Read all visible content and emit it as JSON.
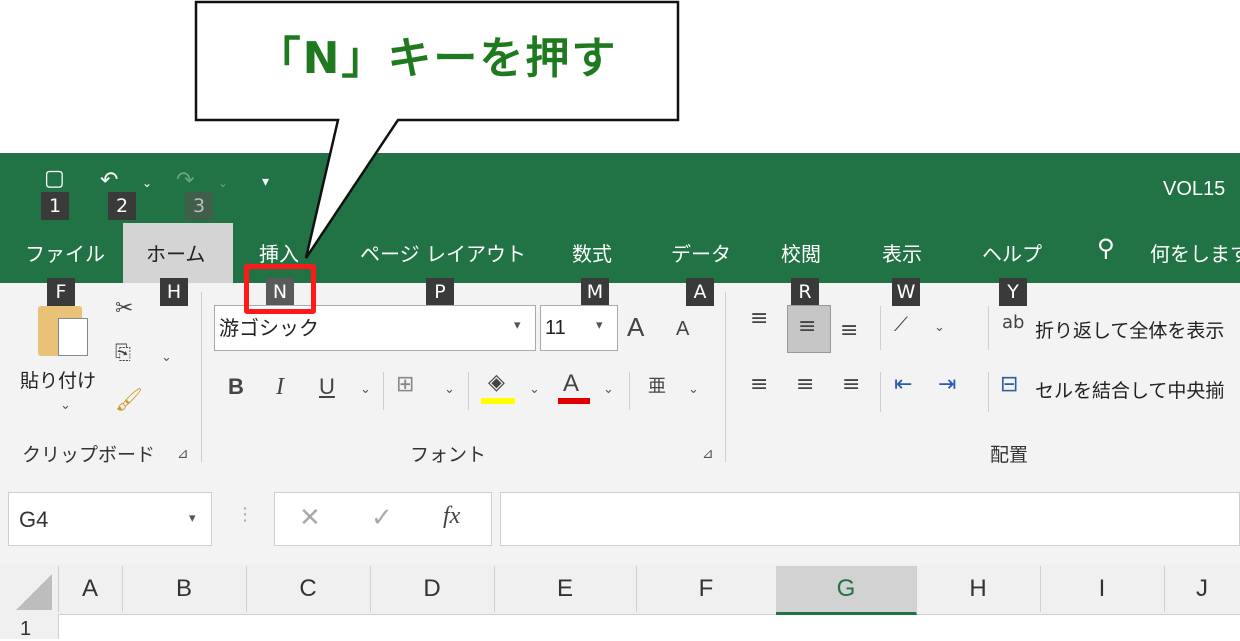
{
  "callout": {
    "text": "「N」キーを押す"
  },
  "window": {
    "title": "VOL15"
  },
  "qat": {
    "save_key": "1",
    "undo_key": "2",
    "redo_key": "3"
  },
  "tabs": [
    {
      "label": "ファイル",
      "key": "F"
    },
    {
      "label": "ホーム",
      "key": "H"
    },
    {
      "label": "挿入",
      "key": "N"
    },
    {
      "label": "ページ レイアウト",
      "key": "P"
    },
    {
      "label": "数式",
      "key": "M"
    },
    {
      "label": "データ",
      "key": "A"
    },
    {
      "label": "校閲",
      "key": "R"
    },
    {
      "label": "表示",
      "key": "W"
    },
    {
      "label": "ヘルプ",
      "key": "Y"
    }
  ],
  "tellme": {
    "label": "何をします"
  },
  "ribbon": {
    "clipboard": {
      "paste_label": "貼り付け",
      "group_label": "クリップボード"
    },
    "font": {
      "font_name": "游ゴシック",
      "font_size": "11",
      "group_label": "フォント",
      "bold": "B",
      "italic": "I",
      "underline": "U",
      "grow": "A",
      "shrink": "A",
      "font_color": "A"
    },
    "alignment": {
      "wrap_label": "折り返して全体を表示",
      "merge_label": "セルを結合して中央揃",
      "group_label": "配置"
    }
  },
  "formula_bar": {
    "name_box": "G4",
    "fx": "fx",
    "value": ""
  },
  "columns": [
    "A",
    "B",
    "C",
    "D",
    "E",
    "F",
    "G",
    "H",
    "I",
    "J"
  ],
  "rows": [
    "1"
  ],
  "colors": {
    "accent": "#217346",
    "highlight": "#ff1a1a",
    "callout_text": "#1f7a1f"
  }
}
